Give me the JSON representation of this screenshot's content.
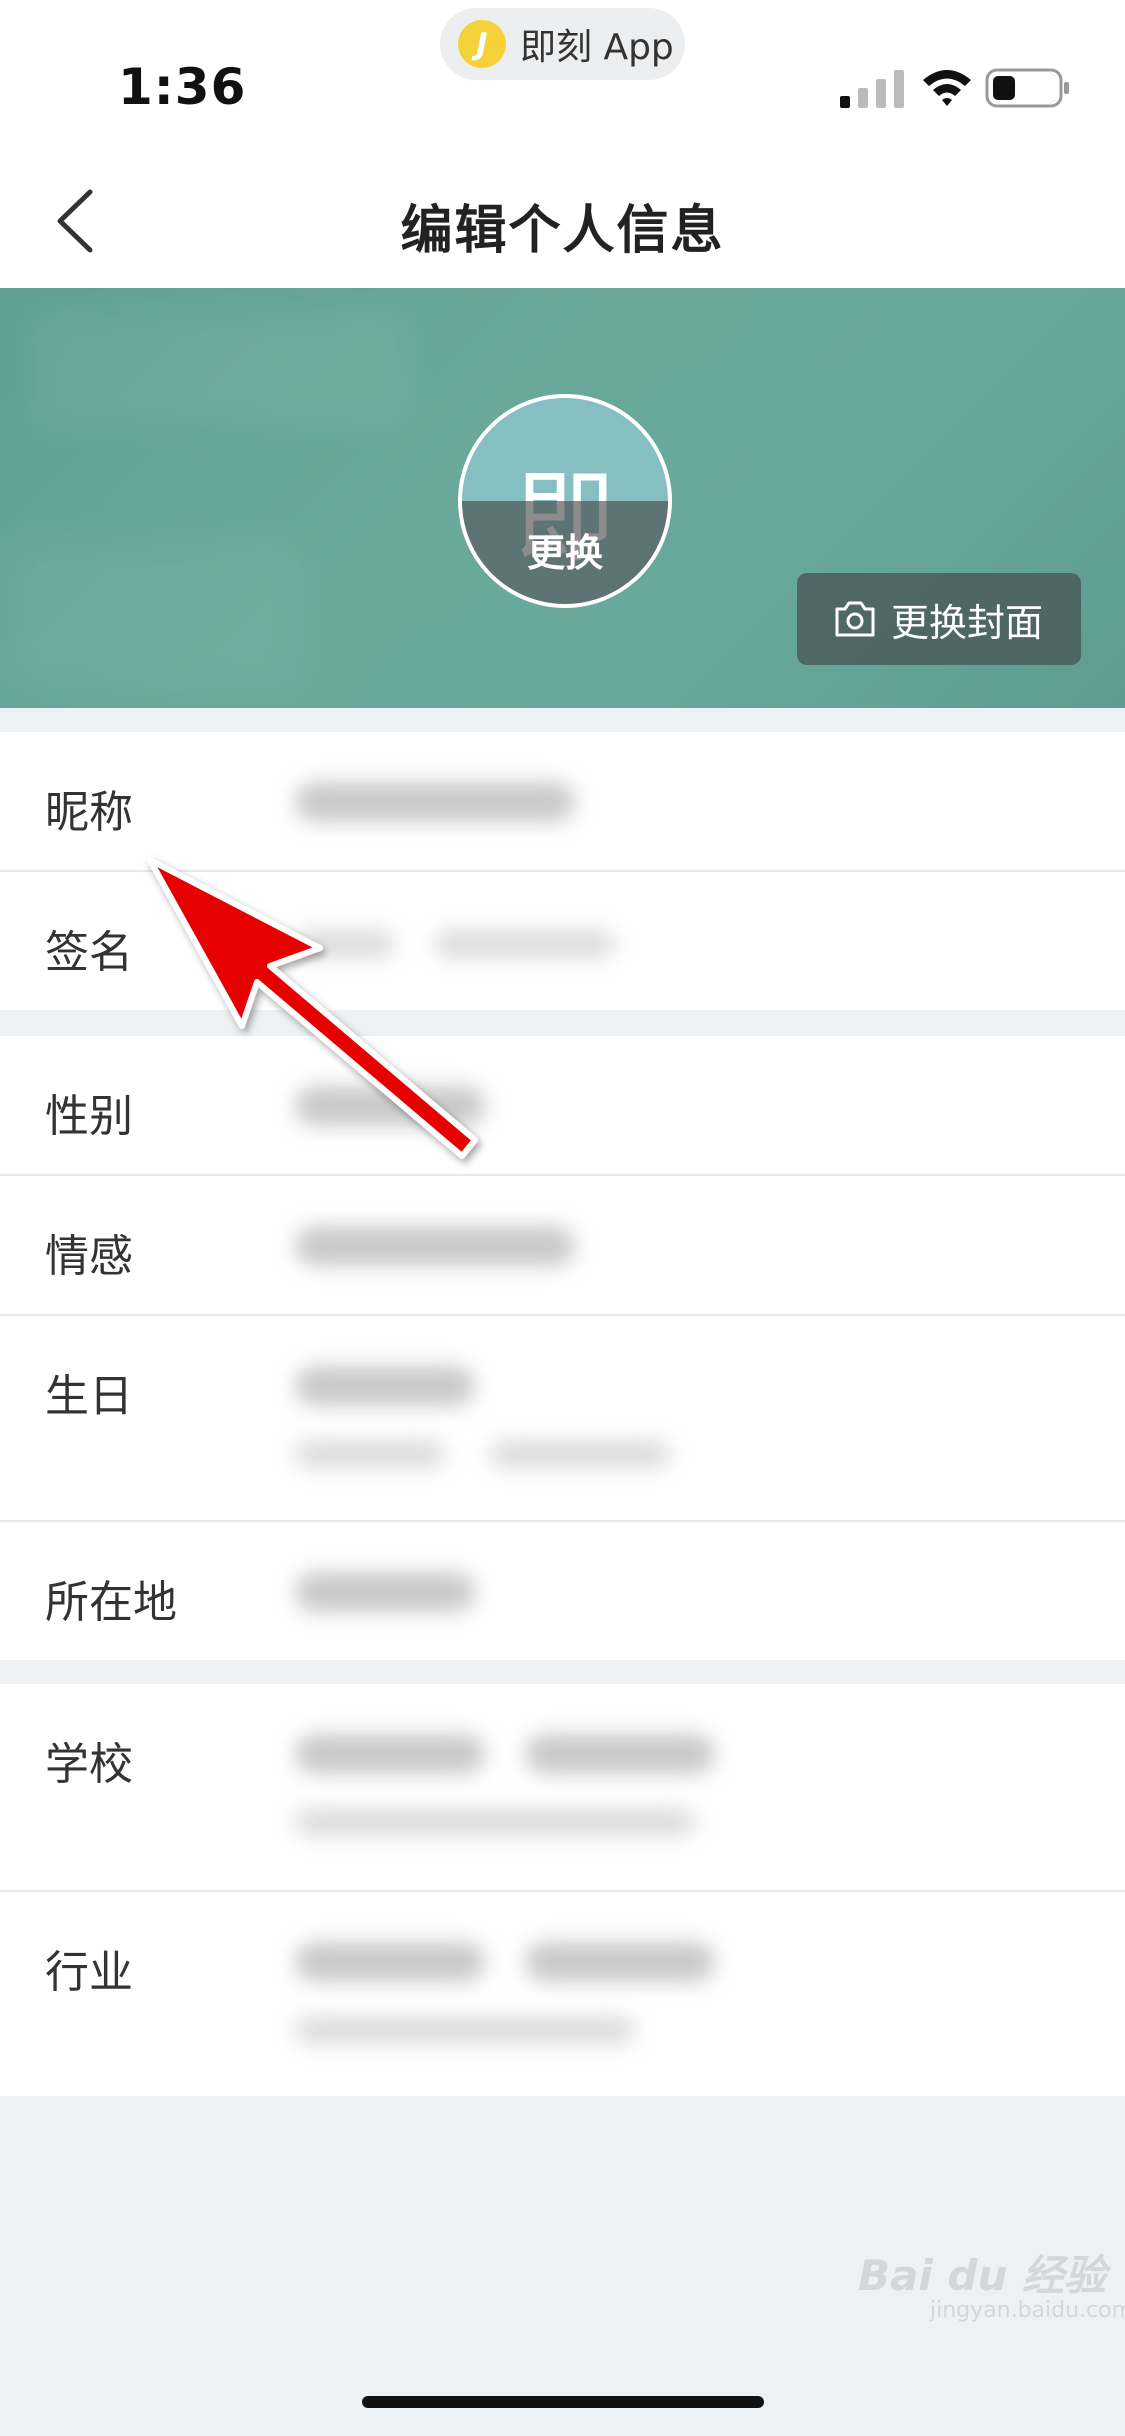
{
  "status": {
    "time": "1:36",
    "app_name": "即刻 App",
    "app_logo": "J"
  },
  "nav": {
    "title": "编辑个人信息"
  },
  "cover": {
    "avatar_char": "即",
    "avatar_change_label": "更换",
    "change_cover_label": "更换封面"
  },
  "fields": {
    "nickname": "昵称",
    "signature": "签名",
    "gender": "性别",
    "relationship": "情感",
    "birthday": "生日",
    "location": "所在地",
    "school": "学校",
    "industry": "行业"
  },
  "watermark": {
    "brand": "Bai du 经验",
    "url": "jingyan.baidu.com"
  },
  "colors": {
    "cover": "#68a79b",
    "arrow": "#e60000",
    "background": "#eef1f3"
  }
}
